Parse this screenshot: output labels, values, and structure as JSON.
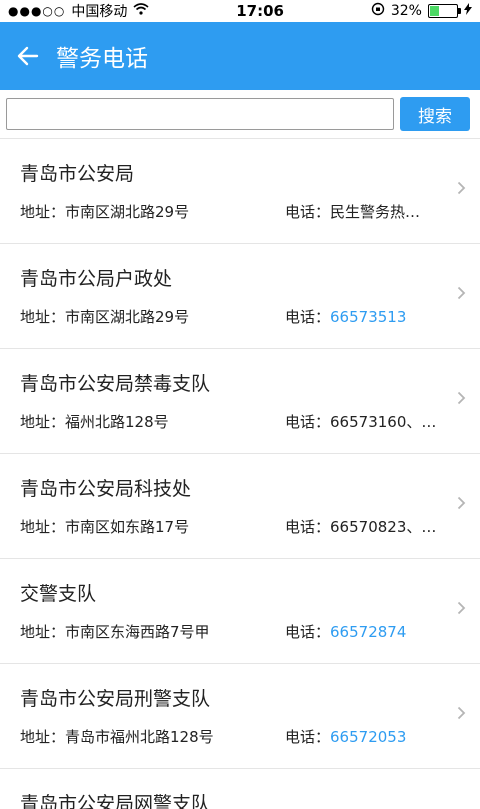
{
  "status": {
    "signal": "●●●○○",
    "carrier": "中国移动",
    "time": "17:06",
    "battery_pct": "32%"
  },
  "header": {
    "back_icon": "arrow-left-icon",
    "title": "警务电话"
  },
  "search": {
    "input_value": "",
    "placeholder": "",
    "button": "搜索"
  },
  "items": [
    {
      "name": "青岛市公安局",
      "addr": "地址：市南区湖北路29号",
      "tel_label": "电话：",
      "tel": "民生警务热…",
      "tel_link": false
    },
    {
      "name": "青岛市公局户政处",
      "addr": "地址：市南区湖北路29号",
      "tel_label": "电话：",
      "tel": "66573513",
      "tel_link": true
    },
    {
      "name": "青岛市公安局禁毒支队",
      "addr": "地址：福州北路128号",
      "tel_label": "电话：",
      "tel": "66573160、…",
      "tel_link": false
    },
    {
      "name": "青岛市公安局科技处",
      "addr": "地址：市南区如东路17号",
      "tel_label": "电话：",
      "tel": "66570823、…",
      "tel_link": false
    },
    {
      "name": "交警支队",
      "addr": "地址：市南区东海西路7号甲",
      "tel_label": "电话：",
      "tel": "66572874",
      "tel_link": true
    },
    {
      "name": "青岛市公安局刑警支队",
      "addr": "地址：青岛市福州北路128号",
      "tel_label": "电话：",
      "tel": "66572053",
      "tel_link": true
    }
  ],
  "partial_item": {
    "name": "青岛市公安局网警支队"
  },
  "colors": {
    "accent": "#2e9cf1",
    "link": "#2e9cf1"
  }
}
